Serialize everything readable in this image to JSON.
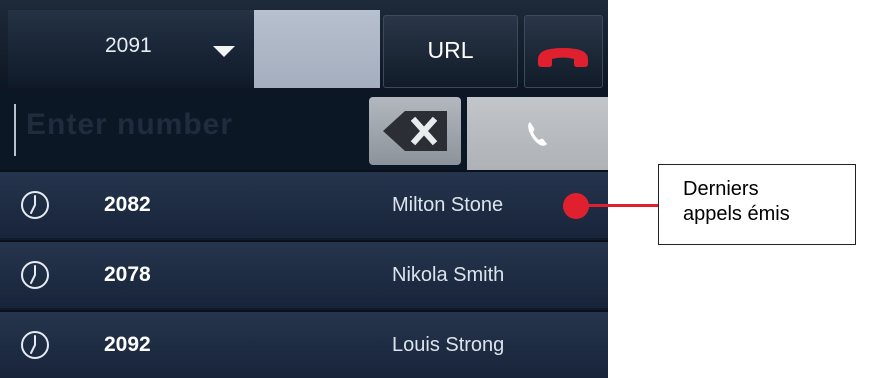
{
  "header": {
    "line_number": "2091",
    "url_label": "URL"
  },
  "dialer": {
    "placeholder": "Enter number"
  },
  "recent_calls": [
    {
      "number": "2082",
      "name": "Milton Stone"
    },
    {
      "number": "2078",
      "name": "Nikola Smith"
    },
    {
      "number": "2092",
      "name": "Louis Strong"
    }
  ],
  "annotation": {
    "line1": "Derniers",
    "line2": "appels émis"
  },
  "colors": {
    "hangup_red": "#e0202f",
    "callout_marker": "#e0202f",
    "list_row": "#25354d",
    "top_bar": "#1e2a3a"
  },
  "icons": {
    "line_dropdown": "chevron-down-icon",
    "hangup": "hangup-phone-icon",
    "backspace": "backspace-icon",
    "call": "phone-icon",
    "history": "clock-icon"
  }
}
